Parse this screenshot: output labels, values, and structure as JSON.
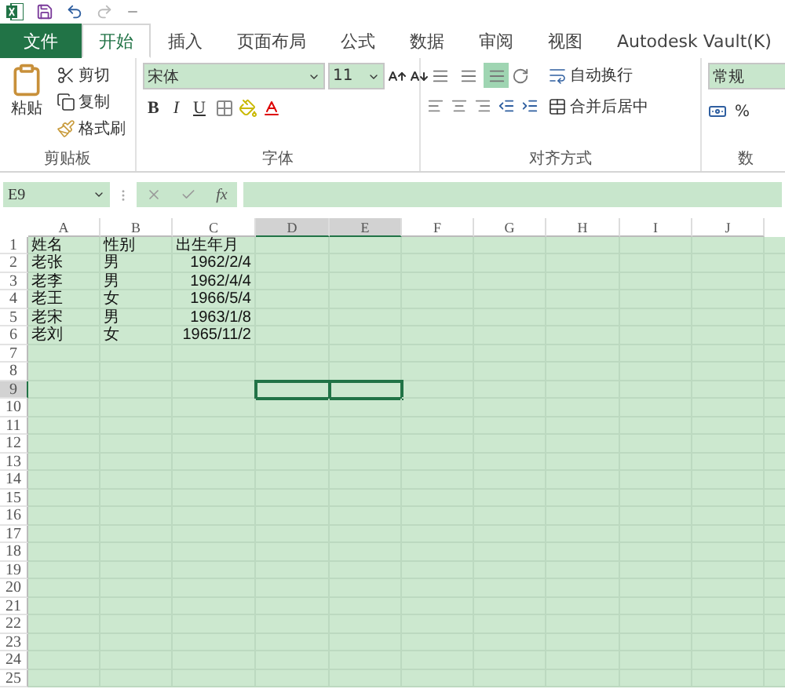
{
  "tabs": [
    {
      "label": "文件",
      "kind": "file",
      "selected": false
    },
    {
      "label": "开始",
      "kind": "tab",
      "selected": true
    },
    {
      "label": "插入",
      "kind": "tab",
      "selected": false
    },
    {
      "label": "页面布局",
      "kind": "tab",
      "selected": false
    },
    {
      "label": "公式",
      "kind": "tab",
      "selected": false
    },
    {
      "label": "数据",
      "kind": "tab",
      "selected": false
    },
    {
      "label": "审阅",
      "kind": "tab",
      "selected": false
    },
    {
      "label": "视图",
      "kind": "tab",
      "selected": false
    },
    {
      "label": "Autodesk Vault(K)",
      "kind": "tab",
      "selected": false
    }
  ],
  "clipboard": {
    "paste": "粘贴",
    "cut": "剪切",
    "copy": "复制",
    "format_painter": "格式刷",
    "group_label": "剪贴板"
  },
  "font": {
    "name": "宋体",
    "size": "11",
    "bold": "B",
    "italic": "I",
    "underline": "U",
    "group_label": "字体"
  },
  "alignment": {
    "vertical": [
      {
        "selected": false
      },
      {
        "selected": false
      },
      {
        "selected": true
      }
    ],
    "wrap_text": "自动换行",
    "merge_center": "合并后居中",
    "group_label": "对齐方式"
  },
  "number": {
    "format": "常规",
    "percent": "%",
    "group_label": "数"
  },
  "formula_bar": {
    "name_box": "E9",
    "function_label": "fx"
  },
  "sheet": {
    "columns": [
      {
        "label": "A",
        "selected": false
      },
      {
        "label": "B",
        "selected": false
      },
      {
        "label": "C",
        "selected": false
      },
      {
        "label": "D",
        "selected": true
      },
      {
        "label": "E",
        "selected": true
      },
      {
        "label": "F",
        "selected": false
      },
      {
        "label": "G",
        "selected": false
      },
      {
        "label": "H",
        "selected": false
      },
      {
        "label": "I",
        "selected": false
      },
      {
        "label": "J",
        "selected": false
      }
    ],
    "rows": [
      {
        "label": "1",
        "selected": false,
        "cells": [
          {
            "text": "姓名",
            "kind": "text"
          },
          {
            "text": "性别",
            "kind": "text"
          },
          {
            "text": "出生年月",
            "kind": "text"
          }
        ]
      },
      {
        "label": "2",
        "selected": false,
        "cells": [
          {
            "text": "老张",
            "kind": "text"
          },
          {
            "text": "男",
            "kind": "text"
          },
          {
            "text": "1962/2/4",
            "kind": "date"
          }
        ]
      },
      {
        "label": "3",
        "selected": false,
        "cells": [
          {
            "text": "老李",
            "kind": "text"
          },
          {
            "text": "男",
            "kind": "text"
          },
          {
            "text": "1962/4/4",
            "kind": "date"
          }
        ]
      },
      {
        "label": "4",
        "selected": false,
        "cells": [
          {
            "text": "老王",
            "kind": "text"
          },
          {
            "text": "女",
            "kind": "text"
          },
          {
            "text": "1966/5/4",
            "kind": "date"
          }
        ]
      },
      {
        "label": "5",
        "selected": false,
        "cells": [
          {
            "text": "老宋",
            "kind": "text"
          },
          {
            "text": "男",
            "kind": "text"
          },
          {
            "text": "1963/1/8",
            "kind": "date"
          }
        ]
      },
      {
        "label": "6",
        "selected": false,
        "cells": [
          {
            "text": "老刘",
            "kind": "text"
          },
          {
            "text": "女",
            "kind": "text"
          },
          {
            "text": "1965/11/2",
            "kind": "date"
          }
        ]
      },
      {
        "label": "7",
        "selected": false,
        "cells": []
      },
      {
        "label": "8",
        "selected": false,
        "cells": []
      },
      {
        "label": "9",
        "selected": true,
        "cells": []
      },
      {
        "label": "10",
        "selected": false,
        "cells": []
      },
      {
        "label": "11",
        "selected": false,
        "cells": []
      },
      {
        "label": "12",
        "selected": false,
        "cells": []
      },
      {
        "label": "13",
        "selected": false,
        "cells": []
      },
      {
        "label": "14",
        "selected": false,
        "cells": []
      },
      {
        "label": "15",
        "selected": false,
        "cells": []
      },
      {
        "label": "16",
        "selected": false,
        "cells": []
      },
      {
        "label": "17",
        "selected": false,
        "cells": []
      },
      {
        "label": "18",
        "selected": false,
        "cells": []
      },
      {
        "label": "19",
        "selected": false,
        "cells": []
      },
      {
        "label": "20",
        "selected": false,
        "cells": []
      },
      {
        "label": "21",
        "selected": false,
        "cells": []
      },
      {
        "label": "22",
        "selected": false,
        "cells": []
      },
      {
        "label": "23",
        "selected": false,
        "cells": []
      },
      {
        "label": "24",
        "selected": false,
        "cells": []
      },
      {
        "label": "25",
        "selected": false,
        "cells": []
      }
    ]
  }
}
